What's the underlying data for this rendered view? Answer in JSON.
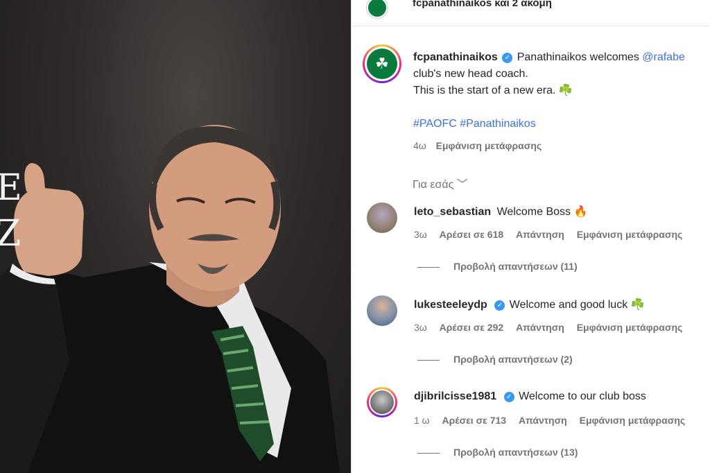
{
  "header": {
    "top_text": "fcpanathinaikos και 2 ακόμη"
  },
  "post": {
    "username": "fcpanathinaikos",
    "caption_line1": "Panathinaikos welcomes ",
    "mention": "@rafabe",
    "caption_line2": "club's new head coach.",
    "caption_line3": "This is the start of a new era. ",
    "shamrock": "☘️",
    "hashtags": "#PAOFC #Panathinaikos",
    "time": "4ω",
    "translate": "Εμφάνιση μετάφρασης"
  },
  "for_you_label": "Για εσάς",
  "comments": [
    {
      "username": "leto_sebastian",
      "verified": false,
      "text": "Welcome Boss 🔥",
      "time": "3ω",
      "likes": "Αρέσει σε 618",
      "reply": "Απάντηση",
      "translate": "Εμφάνιση μετάφρασης",
      "view_replies": "Προβολή απαντήσεων (11)"
    },
    {
      "username": "lukesteeleydp",
      "verified": true,
      "text": "Welcome and good luck ☘️",
      "time": "3ω",
      "likes": "Αρέσει σε 292",
      "reply": "Απάντηση",
      "translate": "Εμφάνιση μετάφρασης",
      "view_replies": "Προβολή απαντήσεων (2)"
    },
    {
      "username": "djibrilcisse1981",
      "verified": true,
      "text": "Welcome to our club boss",
      "time": "1 ω",
      "likes": "Αρέσει σε 713",
      "reply": "Απάντηση",
      "translate": "Εμφάνιση μετάφρασης",
      "view_replies": "Προβολή απαντήσεων (13)"
    }
  ],
  "photo": {
    "side_letters": [
      "E",
      "Z"
    ]
  },
  "colors": {
    "link": "#3e6fd8",
    "verified": "#3897f0",
    "club_green": "#0b7a3e",
    "muted_text": "#737373"
  }
}
